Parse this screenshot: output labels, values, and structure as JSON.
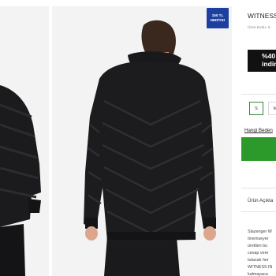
{
  "gallery": {
    "images": [
      {
        "icon": "jacket-side-view-photo"
      },
      {
        "icon": "jacket-back-view-photo"
      }
    ],
    "badge": {
      "line1": "150 TL",
      "line2": "HEDİYE!"
    }
  },
  "product": {
    "title": "WITNESS",
    "code_label": "Ürün Kodu: S",
    "discount": {
      "line1": "%40",
      "line2": "indirim"
    },
    "sizes": [
      {
        "label": "S",
        "selected": true
      },
      {
        "label": "M",
        "selected": false
      }
    ],
    "size_guide": "Hangi Beden",
    "cart_button_color": "#2b9a2a",
    "tab_label": "Ürün Açıkla",
    "description_lines": [
      "Slazenger W",
      "önemseyer",
      "üretilen bu",
      "cevap vere",
      "tutacak her",
      "WITNESS IN",
      "kalmayaca"
    ]
  }
}
